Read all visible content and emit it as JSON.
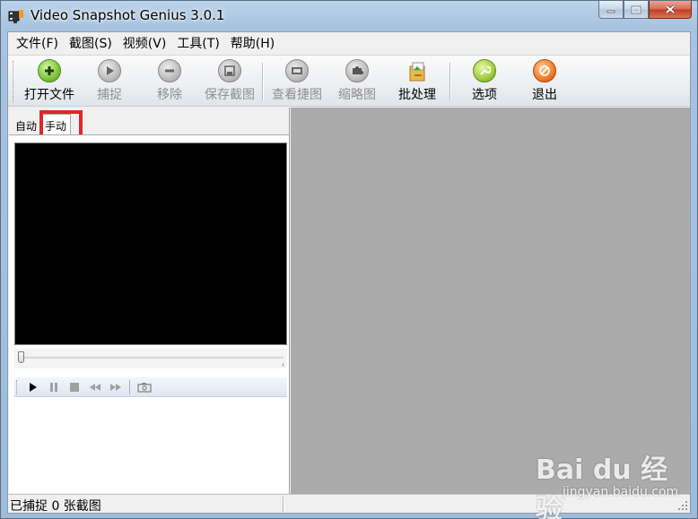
{
  "window": {
    "title": "Video Snapshot Genius 3.0.1"
  },
  "menu": [
    {
      "label": "文件(F)"
    },
    {
      "label": "截图(S)"
    },
    {
      "label": "视频(V)"
    },
    {
      "label": "工具(T)"
    },
    {
      "label": "帮助(H)"
    }
  ],
  "toolbar": {
    "open_file": "打开文件",
    "capture": "捕捉",
    "remove": "移除",
    "save_shots": "保存截图",
    "view_shots": "查看捷图",
    "thumbnails": "缩略图",
    "batch": "批处理",
    "options": "选项",
    "exit": "退出"
  },
  "tabs": {
    "auto": "自动",
    "manual": "手动",
    "active": "manual"
  },
  "player": {
    "seek_position": 0
  },
  "status": {
    "text": "已捕捉 0 张截图"
  },
  "watermark": {
    "logo": "Bai du 经验",
    "url": "jingyan.baidu.com"
  },
  "colors": {
    "highlight_box": "#e0262b",
    "green_button": "#7cc63c",
    "orange_button": "#f07b2a",
    "right_pane": "#ababab"
  }
}
